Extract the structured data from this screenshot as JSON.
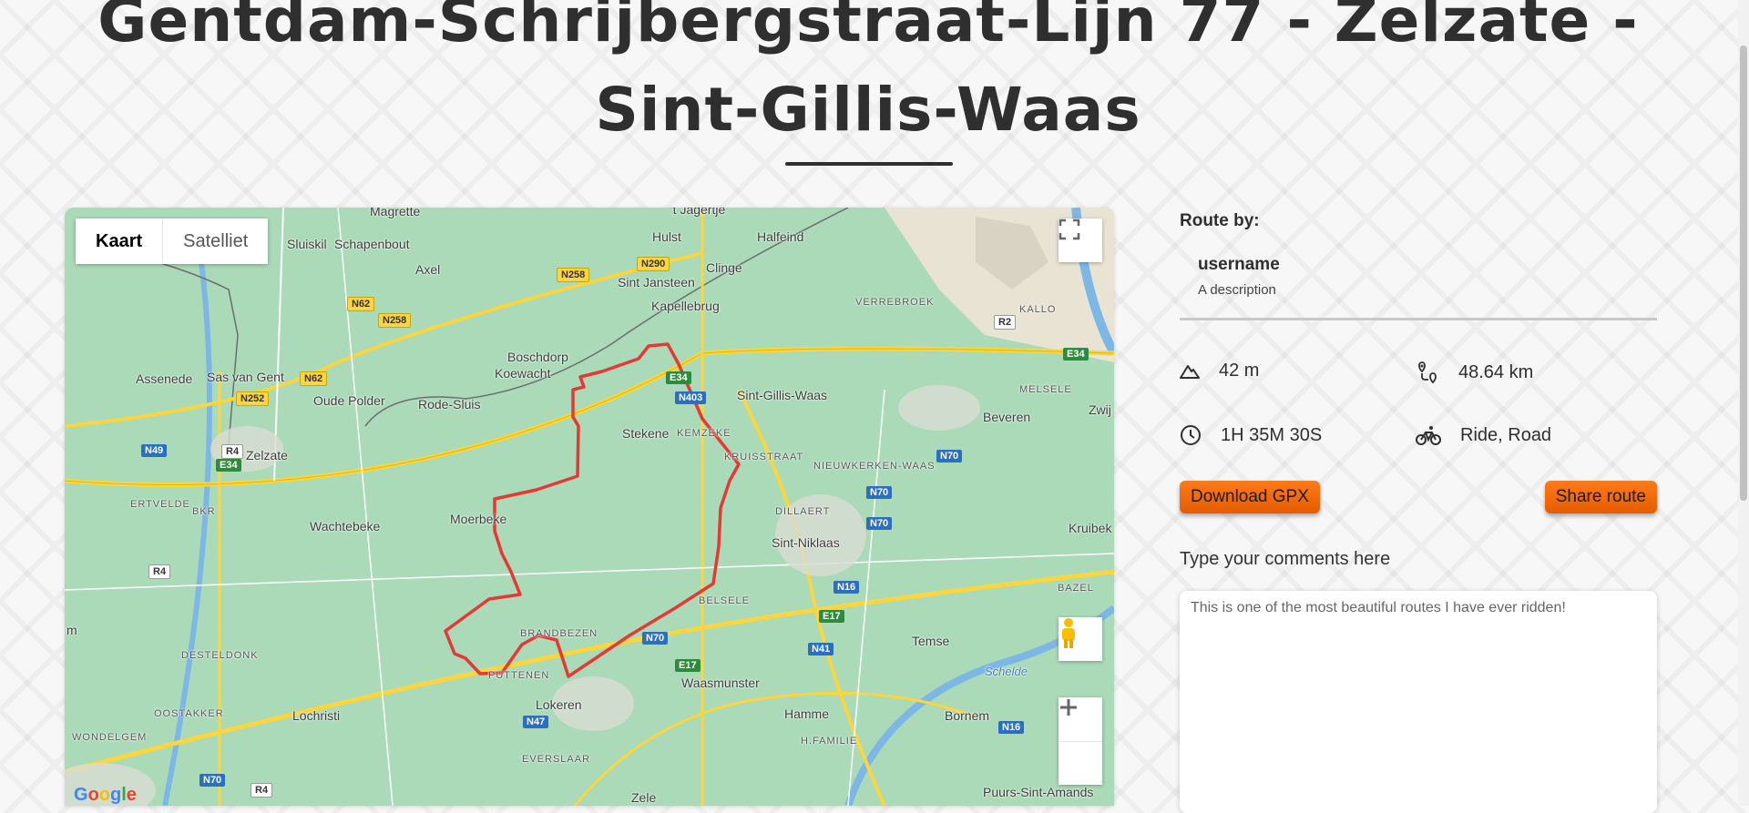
{
  "page": {
    "title": "Gentdam-Schrijbergstraat-Lijn 77 - Zelzate - Sint-Gillis-Waas"
  },
  "map": {
    "maptype_buttons": [
      "Kaart",
      "Satelliet"
    ],
    "places": [
      "Magrette",
      "'t Jagertje",
      "Hulst",
      "Halfeind",
      "Sluiskil",
      "Schapenbout",
      "Axel",
      "Sint Jansteen",
      "Clinge",
      "Kapellebrug",
      "VERREBROEK",
      "KALLO",
      "Boschdorp",
      "Koewacht",
      "Assenede",
      "Sas van Gent",
      "Oude Polder",
      "Rode-Sluis",
      "Sint-Gillis-Waas",
      "MELSELE",
      "Zwij",
      "Stekene",
      "KEMZEKE",
      "Beveren",
      "Zelzate",
      "KRUISSTRAAT",
      "NIEUWKERKEN-WAAS",
      "ERTVELDE",
      "BKR",
      "Wachtebeke",
      "Moerbeke",
      "DILLAERT",
      "Sint-Niklaas",
      "Kruibek",
      "BAZEL",
      "BELSELE",
      "BRANDBEZEN",
      "DESTELDONK",
      "Temse",
      "PUTTENEN",
      "Waasmunster",
      "Lokeren",
      "OOSTAKKER",
      "Lochristi",
      "Hamme",
      "Bornem",
      "WONDELGEM",
      "H.FAMILIE",
      "EVERSLAAR",
      "Puurs-Sint-Amands",
      "Zele",
      "m"
    ],
    "roads": [
      "N258",
      "N290",
      "N62",
      "N258",
      "N252",
      "N62",
      "E34",
      "N403",
      "N49",
      "R4",
      "E34",
      "N70",
      "N70",
      "N70",
      "R4",
      "N16",
      "E17",
      "N70",
      "N41",
      "E17",
      "N47",
      "N16",
      "N70",
      "R4",
      "R2",
      "E34"
    ],
    "river_label": "Schelde",
    "logo": "Google",
    "colors": {
      "route": "#e53935",
      "land": "#aadab7",
      "road_major": "#fcd53f"
    }
  },
  "sidebar": {
    "route_by_label": "Route by:",
    "username": "username",
    "description": "A description",
    "stats": {
      "elevation": "42 m",
      "distance": "48.64 km",
      "duration": "1H 35M 30S",
      "activity": "Ride, Road"
    },
    "download_label": "Download GPX",
    "share_label": "Share route",
    "comments_label": "Type your comments here",
    "comments_value": "This is one of the most beautiful routes I have ever ridden!",
    "colors": {
      "button": "#f06a0c"
    }
  },
  "icons": [
    "fullscreen-icon",
    "pegman-icon",
    "zoom-in-icon",
    "zoom-out-icon",
    "mountain-icon",
    "route-pin-icon",
    "clock-icon",
    "bicycle-icon"
  ]
}
